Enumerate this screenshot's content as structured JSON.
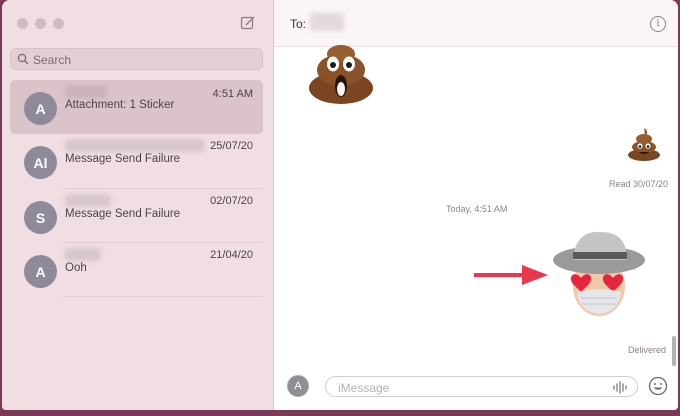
{
  "search": {
    "placeholder": "Search"
  },
  "conversations": [
    {
      "avatar": "A",
      "preview": "Attachment: 1 Sticker",
      "time": "4:51 AM",
      "selected": true
    },
    {
      "avatar": "Al",
      "preview": "Message Send Failure",
      "time": "25/07/20"
    },
    {
      "avatar": "S",
      "preview": "Message Send Failure",
      "time": "02/07/20"
    },
    {
      "avatar": "A",
      "preview": "Ooh",
      "time": "21/04/20"
    }
  ],
  "chat": {
    "to_label": "To:",
    "read_status": "Read 30/07/20",
    "timestamp": "Today, 4:51 AM",
    "delivered": "Delivered"
  },
  "composer": {
    "placeholder": "iMessage"
  },
  "icons": [
    "compose-icon",
    "search-icon",
    "info-icon",
    "app-store-icon",
    "audio-waveform-icon",
    "emoji-icon"
  ],
  "colors": {
    "sidebar": "#f1dee2",
    "selected": "#dac4ca",
    "arrow": "#e8374f",
    "avatar": "#8e8a99"
  }
}
